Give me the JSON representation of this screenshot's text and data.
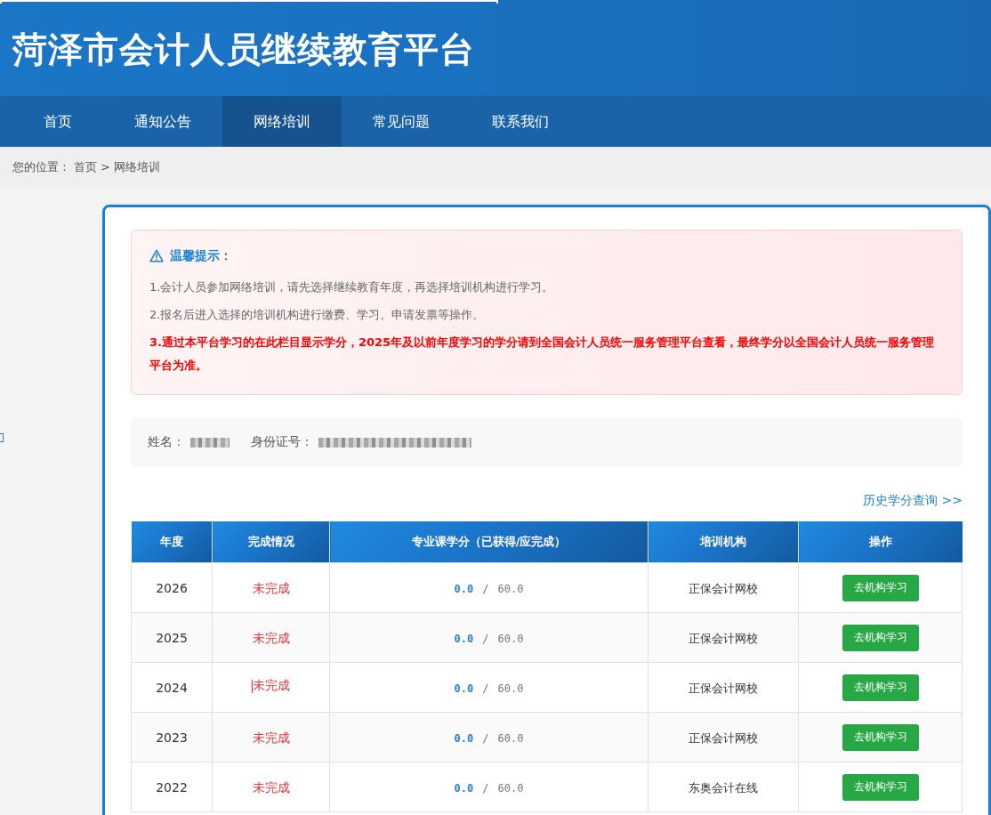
{
  "header": {
    "title": "菏泽市会计人员继续教育平台"
  },
  "nav": {
    "items": [
      {
        "label": "首页",
        "selected": false
      },
      {
        "label": "通知公告",
        "selected": false
      },
      {
        "label": "网络培训",
        "selected": true
      },
      {
        "label": "常见问题",
        "selected": false
      },
      {
        "label": "联系我们",
        "selected": false
      }
    ]
  },
  "breadcrumb": {
    "prefix": "您的位置：",
    "separator": ">",
    "items": [
      "首页",
      "网络培训"
    ]
  },
  "notice": {
    "title": "温馨提示：",
    "items": [
      {
        "kind": "normal",
        "text": "1.会计人员参加网络培训，请先选择继续教育年度，再选择培训机构进行学习。"
      },
      {
        "kind": "normal",
        "text": "2.报名后进入选择的培训机构进行缴费、学习。申请发票等操作。"
      },
      {
        "kind": "important",
        "text": "3.通过本平台学习的在此栏目显示学分，2025年及以前年度学习的学分请到全国会计人员统一服务管理平台查看，最终学分以全国会计人员统一服务管理平台为准。"
      }
    ]
  },
  "profile": {
    "fields": [
      {
        "label": "姓名：",
        "kind": "name"
      },
      {
        "label": "身份证号：",
        "kind": "id_number"
      }
    ]
  },
  "history_link": {
    "label": "历史学分查询 >>"
  },
  "table": {
    "columns": [
      "年度",
      "完成情况",
      "专业课学分（已获得/应完成）",
      "培训机构",
      "操作"
    ],
    "rows": [
      {
        "year": "2026",
        "status": "未完成",
        "text_cursor": false,
        "earned": "0.0",
        "separator": "/",
        "required": "60.0",
        "institution": "正保会计网校",
        "action": "去机构学习"
      },
      {
        "year": "2025",
        "status": "未完成",
        "text_cursor": false,
        "earned": "0.0",
        "separator": "/",
        "required": "60.0",
        "institution": "正保会计网校",
        "action": "去机构学习"
      },
      {
        "year": "2024",
        "status": "未完成",
        "text_cursor": true,
        "earned": "0.0",
        "separator": "/",
        "required": "60.0",
        "institution": "正保会计网校",
        "action": "去机构学习"
      },
      {
        "year": "2023",
        "status": "未完成",
        "text_cursor": false,
        "earned": "0.0",
        "separator": "/",
        "required": "60.0",
        "institution": "正保会计网校",
        "action": "去机构学习"
      },
      {
        "year": "2022",
        "status": "未完成",
        "text_cursor": false,
        "earned": "0.0",
        "separator": "/",
        "required": "60.0",
        "institution": "东奥会计在线",
        "action": "去机构学习"
      }
    ]
  }
}
